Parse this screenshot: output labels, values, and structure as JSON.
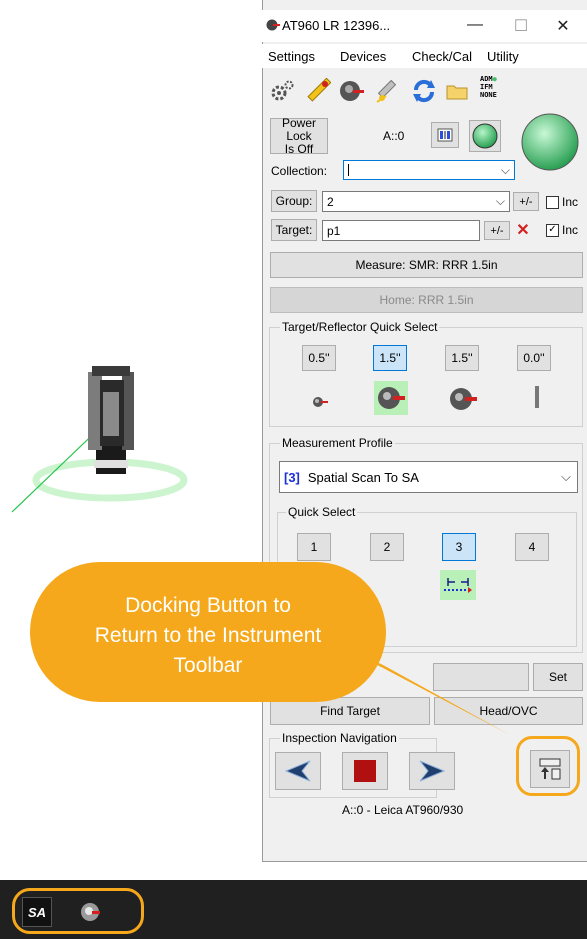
{
  "window": {
    "title": "AT960 LR 12396...",
    "minimize_glyph": "—",
    "maximize_glyph": "☐",
    "close_glyph": "✕"
  },
  "menu": [
    "Settings",
    "Devices",
    "Check/Cal",
    "Utility"
  ],
  "toolbar": {
    "icons": [
      "settings-gears-icon",
      "ruler-icon",
      "tracker-head-icon",
      "satellite-icon",
      "refresh-icon",
      "folder-icon"
    ],
    "adm_label": "ADM",
    "ifm_label": "IFM",
    "none_label": "NONE"
  },
  "power_lock": {
    "line1": "Power Lock",
    "line2": "Is Off"
  },
  "instrument_id": "A::0",
  "collection": {
    "label": "Collection:",
    "value": ""
  },
  "group": {
    "label": "Group:",
    "value": "2",
    "plusminus": "+/-",
    "inc_label": "Inc",
    "inc_checked": false
  },
  "target": {
    "label": "Target:",
    "value": "p1",
    "plusminus": "+/-",
    "inc_label": "Inc",
    "inc_checked": true
  },
  "measure_button": "Measure: SMR: RRR 1.5in",
  "home_button": "Home: RRR 1.5in",
  "reflector_quick_select": {
    "title": "Target/Reflector Quick Select",
    "buttons": [
      "0.5''",
      "1.5''",
      "1.5''",
      "0.0''"
    ],
    "selected_index": 1
  },
  "measurement_profile": {
    "title": "Measurement Profile",
    "number": "[3]",
    "value": "Spatial Scan To SA"
  },
  "quick_select": {
    "title": "Quick Select",
    "buttons": [
      "1",
      "2",
      "3",
      "4"
    ],
    "selected_index": 2
  },
  "set_button": "Set",
  "find_target_button": "Find Target",
  "head_ovc_button": "Head/OVC",
  "inspection_navigation": {
    "title": "Inspection Navigation"
  },
  "status_line": "A::0 - Leica AT960/930",
  "callout": {
    "line1": "Docking Button to",
    "line2": "Return to the Instrument",
    "line3": "Toolbar"
  },
  "taskbar": {
    "sa_label": "SA"
  },
  "colors": {
    "callout": "#f5a81b",
    "highlight_ring": "#f5a81b",
    "status_green": "#3cc46b",
    "stop_red": "#b01010",
    "taskbar": "#202020",
    "selection_blue": "#0078d7"
  }
}
